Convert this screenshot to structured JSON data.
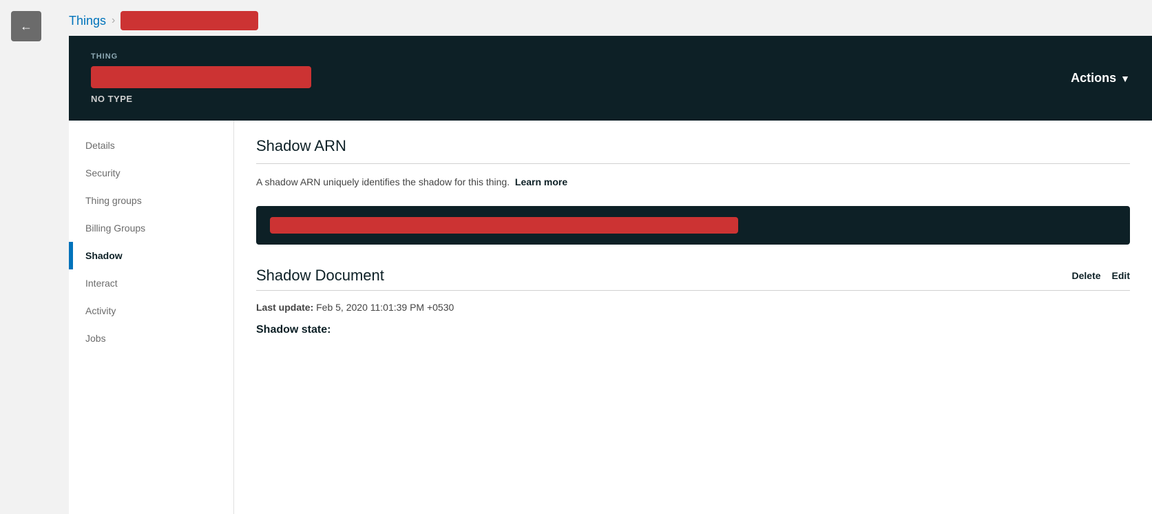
{
  "breadcrumb": {
    "things_label": "Things",
    "separator": "›"
  },
  "header": {
    "thing_label": "THING",
    "thing_type": "NO TYPE",
    "actions_label": "Actions"
  },
  "nav": {
    "items": [
      {
        "id": "details",
        "label": "Details",
        "active": false
      },
      {
        "id": "security",
        "label": "Security",
        "active": false
      },
      {
        "id": "thing-groups",
        "label": "Thing groups",
        "active": false
      },
      {
        "id": "billing-groups",
        "label": "Billing Groups",
        "active": false
      },
      {
        "id": "shadow",
        "label": "Shadow",
        "active": true
      },
      {
        "id": "interact",
        "label": "Interact",
        "active": false
      },
      {
        "id": "activity",
        "label": "Activity",
        "active": false
      },
      {
        "id": "jobs",
        "label": "Jobs",
        "active": false
      }
    ]
  },
  "main": {
    "shadow_arn_title": "Shadow ARN",
    "shadow_arn_description": "A shadow ARN uniquely identifies the shadow for this thing.",
    "learn_more_label": "Learn more",
    "shadow_doc_title": "Shadow Document",
    "delete_label": "Delete",
    "edit_label": "Edit",
    "last_update_label": "Last update:",
    "last_update_value": "Feb 5, 2020 11:01:39 PM +0530",
    "shadow_state_label": "Shadow state:"
  }
}
